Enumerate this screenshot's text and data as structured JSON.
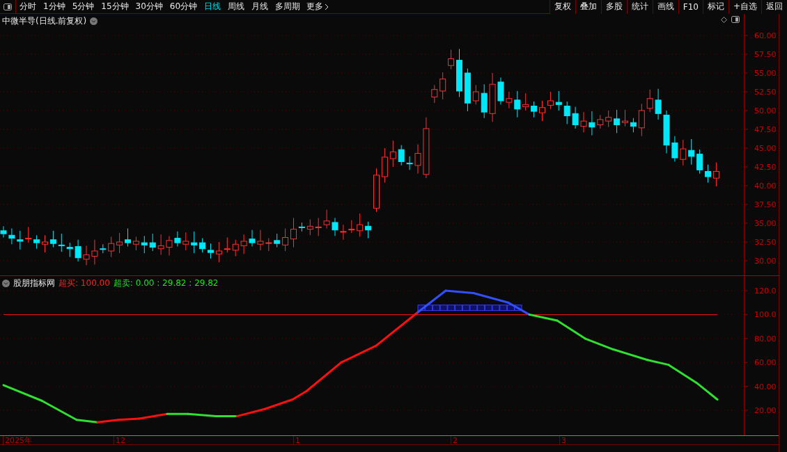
{
  "toolbar": {
    "periods": [
      {
        "label": "分时",
        "selected": false
      },
      {
        "label": "1分钟",
        "selected": false
      },
      {
        "label": "5分钟",
        "selected": false
      },
      {
        "label": "15分钟",
        "selected": false
      },
      {
        "label": "30分钟",
        "selected": false
      },
      {
        "label": "60分钟",
        "selected": false
      },
      {
        "label": "日线",
        "selected": true
      },
      {
        "label": "周线",
        "selected": false
      },
      {
        "label": "月线",
        "selected": false
      },
      {
        "label": "多周期",
        "selected": false
      }
    ],
    "more": "更多",
    "actions": [
      "复权",
      "叠加",
      "多股",
      "统计",
      "画线",
      "F10",
      "标记",
      "+自选",
      "返回"
    ]
  },
  "price_chart": {
    "title": "中微半导(日线.前复权)",
    "y_axis": [
      "60.00",
      "57.50",
      "55.00",
      "52.50",
      "50.00",
      "47.50",
      "45.00",
      "42.50",
      "40.00",
      "37.50",
      "35.00",
      "32.50",
      "30.00"
    ]
  },
  "indicator": {
    "name": "股朋指标网",
    "overbought": "超买: 100.00",
    "oversold": "超卖: 0.00 : 29.82 : 29.82",
    "y_axis": [
      "120.0",
      "100.0",
      "80.00",
      "60.00",
      "40.00",
      "20.00"
    ]
  },
  "date_axis": [
    "2025年",
    "12",
    "1",
    "2",
    "3"
  ]
}
